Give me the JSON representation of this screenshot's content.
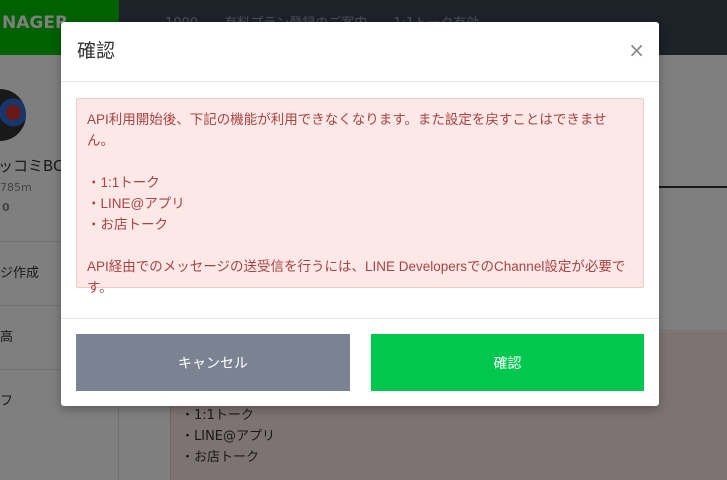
{
  "background": {
    "brand": "NAGER",
    "topnav": [
      "1000",
      "有料プラン登録のご案内",
      "1:1トーク有効"
    ],
    "account": {
      "name": "ッコミBC",
      "sub": "785m",
      "num": "0"
    },
    "sidebar_items": [
      "ジ作成",
      "高",
      "フ"
    ],
    "alert_lines": [
      "・1:1トーク",
      "・LINE@アプリ",
      "・お店トーク"
    ]
  },
  "modal": {
    "title": "確認",
    "close_glyph": "×",
    "message_intro": "API利用開始後、下記の機能が利用できなくなります。また設定を戻すことはできません。",
    "features": [
      "・1:1トーク",
      "・LINE@アプリ",
      "・お店トーク"
    ],
    "message_note": "API経由でのメッセージの送受信を行うには、LINE DevelopersでのChannel設定が必要です。",
    "cancel_label": "キャンセル",
    "confirm_label": "確認"
  },
  "colors": {
    "brand_green": "#00c300",
    "confirm_green": "#00c84f",
    "cancel_gray": "#7b8393",
    "alert_bg": "#fde8e8",
    "alert_text": "#a94442"
  }
}
